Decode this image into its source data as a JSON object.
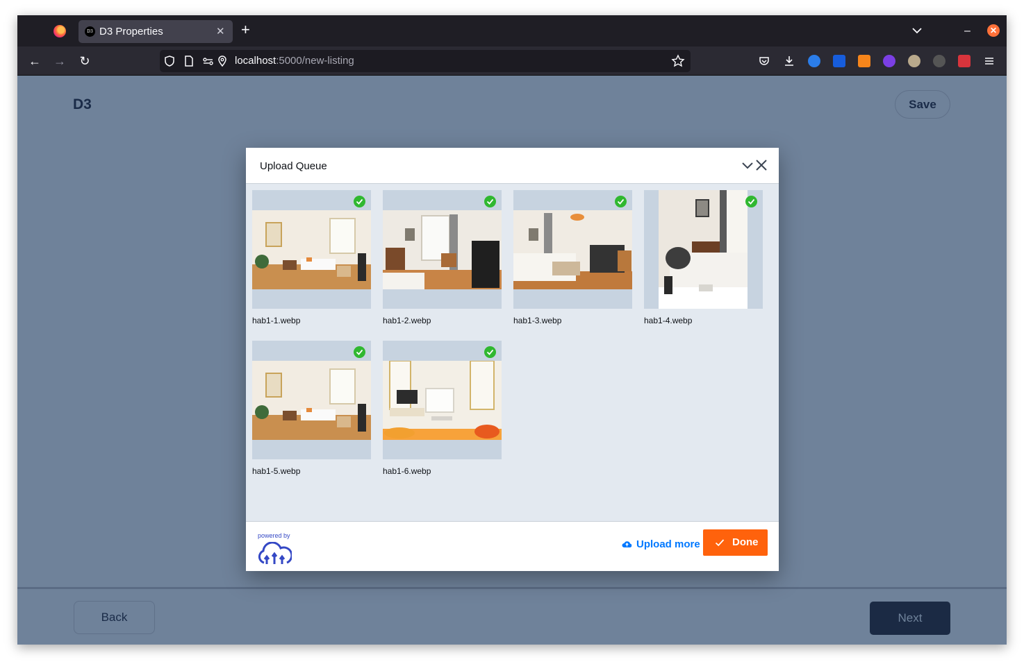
{
  "browser": {
    "tab_title": "D3 Properties",
    "tab_favicon_text": "D3",
    "url_host": "localhost",
    "url_path": ":5000/new-listing",
    "icons": [
      "firefox-logo",
      "tab-close-icon",
      "new-tab-icon",
      "tab-list-icon",
      "minimize-window-icon",
      "close-window-icon",
      "back-icon",
      "forward-icon",
      "reload-icon",
      "shield-icon",
      "page-icon",
      "permissions-icon",
      "location-icon",
      "bookmark-star-icon",
      "pocket-icon",
      "downloads-icon",
      "menu-icon"
    ]
  },
  "page": {
    "logo": "D3",
    "save_label": "Save",
    "back_label": "Back",
    "next_label": "Next"
  },
  "modal": {
    "title": "Upload Queue",
    "files": [
      {
        "name": "hab1-1.webp",
        "status": "uploaded"
      },
      {
        "name": "hab1-2.webp",
        "status": "uploaded"
      },
      {
        "name": "hab1-3.webp",
        "status": "uploaded"
      },
      {
        "name": "hab1-4.webp",
        "status": "uploaded"
      },
      {
        "name": "hab1-5.webp",
        "status": "uploaded"
      },
      {
        "name": "hab1-6.webp",
        "status": "uploaded"
      }
    ],
    "powered_by": "powered by",
    "upload_more_label": "Upload more",
    "done_label": "Done"
  },
  "colors": {
    "page_bg": "#6f829a",
    "accent_orange": "#ff620c",
    "link_blue": "#0078ff",
    "success_green": "#30b830",
    "navy": "#1a2b48"
  }
}
